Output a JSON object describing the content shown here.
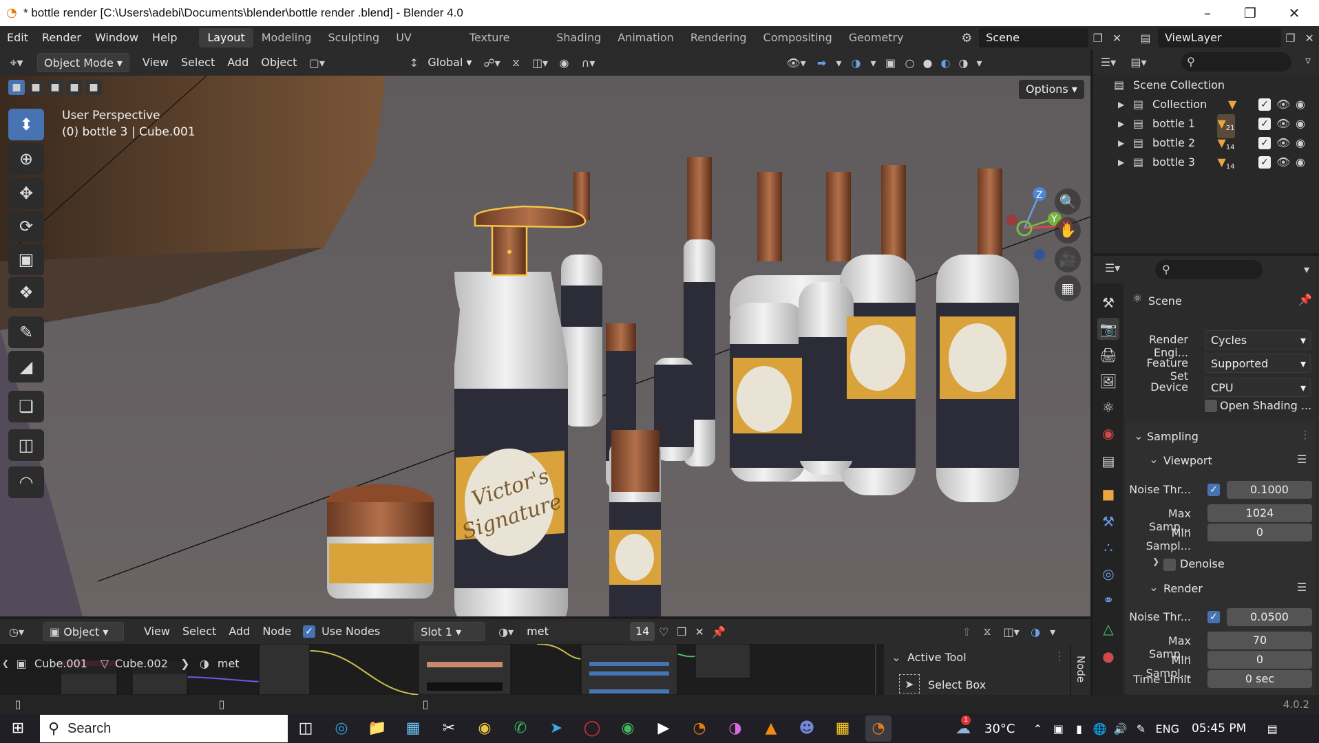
{
  "window": {
    "title": "* bottle render  [C:\\Users\\adebi\\Documents\\blender\\bottle render .blend] - Blender 4.0"
  },
  "menu": [
    "Edit",
    "Render",
    "Window",
    "Help"
  ],
  "workspaces": [
    "Layout",
    "Modeling",
    "Sculpting",
    "UV Editing",
    "Texture Paint",
    "Shading",
    "Animation",
    "Rendering",
    "Compositing",
    "Geometry Nodes"
  ],
  "scene": {
    "name": "Scene",
    "view_layer": "ViewLayer"
  },
  "viewport_header": {
    "mode": "Object Mode",
    "menus": [
      "View",
      "Select",
      "Add",
      "Object"
    ],
    "orientation": "Global",
    "options_label": "Options"
  },
  "viewport": {
    "perspective": "User Perspective",
    "object_info": "(0) bottle 3  | Cube.001",
    "label_text_line1": "Victor's",
    "label_text_line2": "Signature"
  },
  "outliner": {
    "root": "Scene Collection",
    "items": [
      {
        "name": "Collection",
        "badge": ""
      },
      {
        "name": "bottle 1",
        "badge": "21"
      },
      {
        "name": "bottle 2",
        "badge": "14"
      },
      {
        "name": "bottle 3",
        "badge": "14"
      }
    ]
  },
  "properties": {
    "header": "Scene",
    "render_engine_label": "Render Engi...",
    "render_engine": "Cycles",
    "feature_set_label": "Feature Set",
    "feature_set": "Supported",
    "device_label": "Device",
    "device": "CPU",
    "open_shading": "Open Shading ...",
    "sampling": "Sampling",
    "viewport_section": "Viewport",
    "vp_noise_label": "Noise Thr...",
    "vp_noise": "0.1000",
    "vp_max_label": "Max Samp...",
    "vp_max": "1024",
    "vp_min_label": "Min Sampl...",
    "vp_min": "0",
    "denoise": "Denoise",
    "render_section": "Render",
    "r_noise_label": "Noise Thr...",
    "r_noise": "0.0500",
    "r_max_label": "Max Samp...",
    "r_max": "70",
    "r_min_label": "Min Sampl...",
    "r_min": "0",
    "time_limit_label": "Time Limit",
    "time_limit": "0 sec"
  },
  "node_editor": {
    "type": "Object",
    "menus": [
      "View",
      "Select",
      "Add",
      "Node"
    ],
    "use_nodes": "Use Nodes",
    "slot": "Slot 1",
    "material": "met",
    "users": "14",
    "breadcrumb": [
      "Cube.001",
      "Cube.002",
      "met"
    ],
    "active_tool_title": "Active Tool",
    "active_tool": "Select Box",
    "side_tab": "Node"
  },
  "status": {
    "version": "4.0.2"
  },
  "taskbar": {
    "search": "Search",
    "weather": "30°C",
    "weather_badge": "1",
    "lang": "ENG",
    "time": "05:45 PM"
  }
}
